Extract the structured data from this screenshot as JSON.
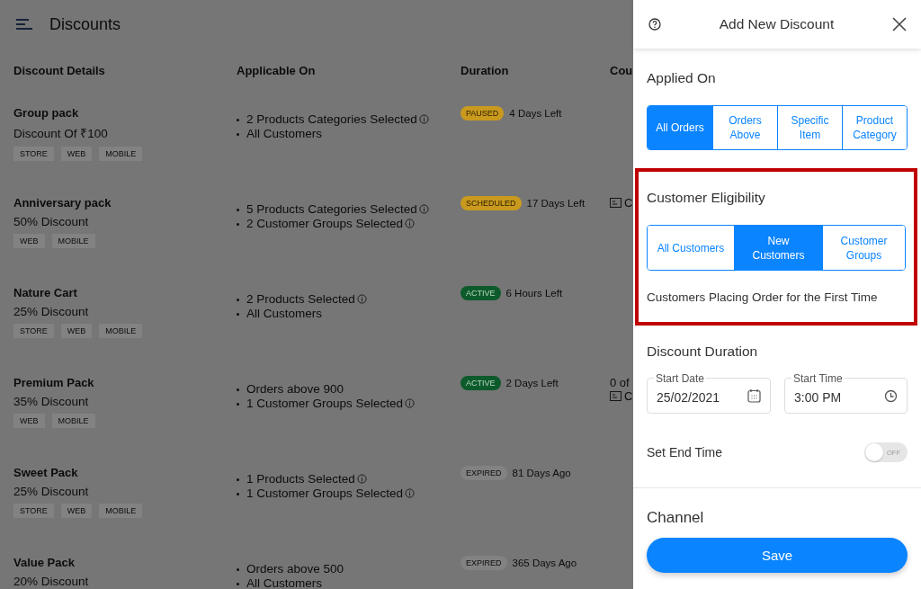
{
  "page": {
    "title": "Discounts"
  },
  "table": {
    "columns": [
      "Discount Details",
      "Applicable On",
      "Duration",
      "Cou"
    ],
    "rows": [
      {
        "name": "Group pack",
        "discount": "Discount Of ₹100",
        "channels": [
          "STORE",
          "WEB",
          "MOBILE"
        ],
        "applicable": [
          {
            "text": "2 Products Categories Selected",
            "info": true
          },
          {
            "text": "All Customers",
            "info": false
          }
        ],
        "status": {
          "kind": "paused",
          "label": "PAUSED"
        },
        "time": "4 Days Left",
        "coupon": []
      },
      {
        "name": "Anniversary pack",
        "discount": "50% Discount",
        "channels": [
          "WEB",
          "MOBILE"
        ],
        "applicable": [
          {
            "text": "5 Products Categories Selected",
            "info": true
          },
          {
            "text": "2 Customer Groups Selected",
            "info": true
          }
        ],
        "status": {
          "kind": "scheduled",
          "label": "SCHEDULED"
        },
        "time": "17 Days Left",
        "coupon": [
          {
            "icon": true,
            "text": "C"
          }
        ]
      },
      {
        "name": "Nature Cart",
        "discount": "25% Discount",
        "channels": [
          "STORE",
          "WEB",
          "MOBILE"
        ],
        "applicable": [
          {
            "text": "2 Products Selected",
            "info": true
          },
          {
            "text": "All Customers",
            "info": false
          }
        ],
        "status": {
          "kind": "active",
          "label": "ACTIVE"
        },
        "time": "6 Hours Left",
        "coupon": []
      },
      {
        "name": "Premium Pack",
        "discount": "35% Discount",
        "channels": [
          "WEB",
          "MOBILE"
        ],
        "applicable": [
          {
            "text": "Orders above 900",
            "info": false
          },
          {
            "text": "1 Customer Groups Selected",
            "info": true
          }
        ],
        "status": {
          "kind": "active",
          "label": "ACTIVE"
        },
        "time": "2 Days Left",
        "coupon": [
          {
            "icon": false,
            "text": "0 of"
          },
          {
            "icon": true,
            "text": "C"
          }
        ]
      },
      {
        "name": "Sweet Pack",
        "discount": "25% Discount",
        "channels": [
          "STORE",
          "WEB",
          "MOBILE"
        ],
        "applicable": [
          {
            "text": "1 Products Selected",
            "info": true
          },
          {
            "text": "1 Customer Groups Selected",
            "info": true
          }
        ],
        "status": {
          "kind": "expired",
          "label": "EXPIRED"
        },
        "time": "81 Days Ago",
        "coupon": []
      },
      {
        "name": "Value Pack",
        "discount": "20% Discount",
        "channels": [],
        "applicable": [
          {
            "text": "Orders above 500",
            "info": false
          },
          {
            "text": "All Customers",
            "info": false
          }
        ],
        "status": {
          "kind": "expired",
          "label": "EXPIRED"
        },
        "time": "365 Days Ago",
        "coupon": []
      }
    ]
  },
  "panel": {
    "title": "Add New Discount",
    "applied_on": {
      "label": "Applied On",
      "options": [
        {
          "label": "All Orders",
          "selected": true
        },
        {
          "label": "Orders Above",
          "selected": false
        },
        {
          "label": "Specific Item",
          "selected": false
        },
        {
          "label": "Product Category",
          "selected": false
        }
      ]
    },
    "eligibility": {
      "label": "Customer Eligibility",
      "options": [
        {
          "label": "All Customers",
          "selected": false
        },
        {
          "label": "New Customers",
          "selected": true
        },
        {
          "label": "Customer Groups",
          "selected": false
        }
      ],
      "description": "Customers Placing Order for the First Time"
    },
    "duration": {
      "label": "Discount Duration",
      "start_date": {
        "label": "Start Date",
        "value": "25/02/2021"
      },
      "start_time": {
        "label": "Start Time",
        "value": "3:00 PM"
      },
      "end_time": {
        "label": "Set End Time",
        "on": false,
        "toggle_text": "OFF"
      }
    },
    "channel": {
      "label": "Channel"
    },
    "save": "Save"
  }
}
